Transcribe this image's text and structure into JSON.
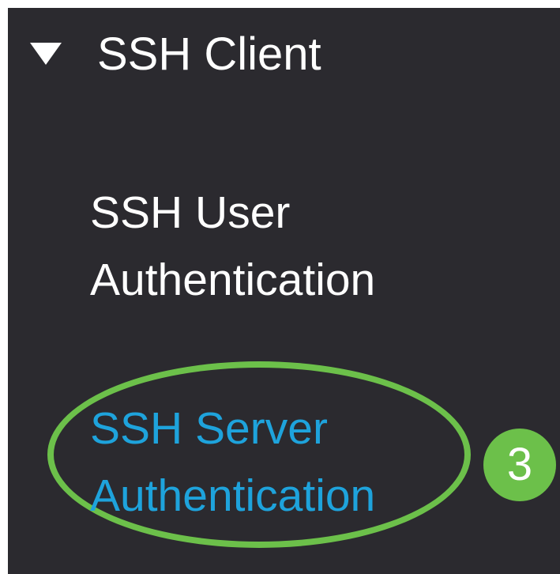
{
  "nav": {
    "section": {
      "icon": "caret-down-icon",
      "label": "SSH Client"
    },
    "items": [
      {
        "label_line1": "SSH User",
        "label_line2": "Authentication",
        "color": "#ffffff",
        "active": false
      },
      {
        "label_line1": "SSH Server",
        "label_line2": "Authentication",
        "color": "#1ea3dc",
        "active": true
      }
    ]
  },
  "annotation": {
    "step_number": "3",
    "ring_color": "#6cc04a",
    "badge_color": "#6cc04a"
  },
  "colors": {
    "panel_background": "#2b2a2f",
    "text": "#ffffff",
    "link_active": "#1ea3dc"
  }
}
